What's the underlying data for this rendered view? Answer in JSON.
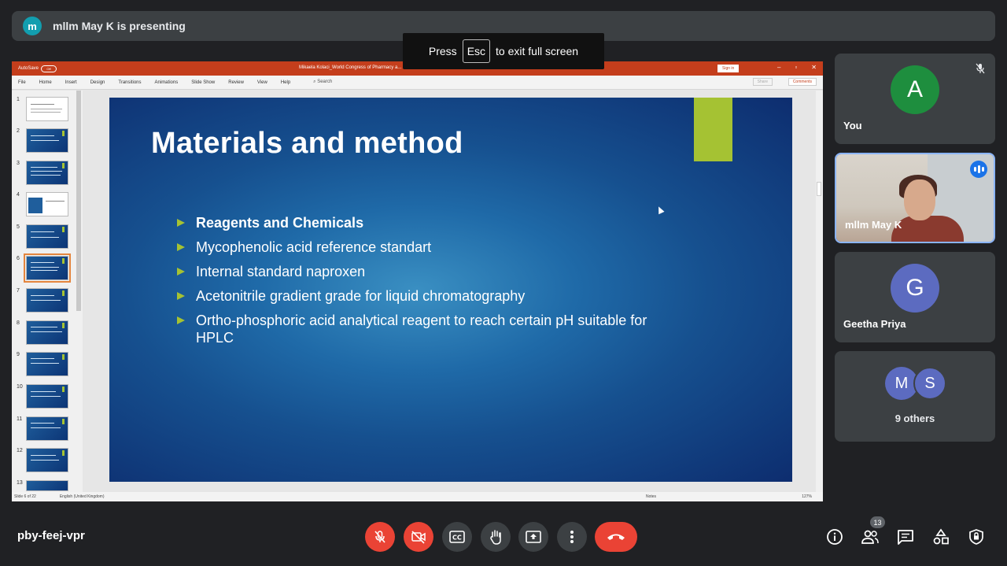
{
  "banner": {
    "avatar_letter": "m",
    "text": "mllm May K is presenting"
  },
  "toast": {
    "prefix": "Press",
    "key": "Esc",
    "suffix": "to exit full screen"
  },
  "ppt": {
    "autosave": "AutoSave",
    "autosave_state": "Off",
    "doc_title": "Mikaela Kolaci_World Congress of Pharmacy a... Clinical Research  -  Protected View  -  Saved to this PC",
    "sign_in": "Sign in",
    "menu": [
      "File",
      "Home",
      "Insert",
      "Design",
      "Transitions",
      "Animations",
      "Slide Show",
      "Review",
      "View",
      "Help"
    ],
    "search": "Search",
    "share": "Share",
    "comments": "Comments",
    "thumb_numbers": [
      "1",
      "2",
      "3",
      "4",
      "5",
      "6",
      "7",
      "8",
      "9",
      "10",
      "11",
      "12",
      "13"
    ],
    "status_slide": "Slide 6 of 22",
    "status_lang": "English (United Kingdom)",
    "status_notes": "Notes",
    "status_zoom": "127%"
  },
  "slide": {
    "title": "Materials and method",
    "bullets": [
      "Reagents and Chemicals",
      "Mycophenolic acid reference standart",
      "Internal standard naproxen",
      "Acetonitrile gradient grade for liquid chromatography",
      "Ortho-phosphoric acid analytical reagent  to reach certain pH suitable for HPLC"
    ],
    "accent_color": "#a5c233"
  },
  "participants": {
    "you": {
      "letter": "A",
      "name": "You",
      "color": "#1e8e3e"
    },
    "presenter": {
      "name": "mllm May K"
    },
    "geetha": {
      "letter": "G",
      "name": "Geetha Priya",
      "color": "#5c6bc0"
    },
    "others": {
      "letters": [
        "M",
        "S"
      ],
      "label": "9 others"
    }
  },
  "bottom": {
    "meeting_code": "pby-feej-vpr",
    "people_count": "13"
  }
}
